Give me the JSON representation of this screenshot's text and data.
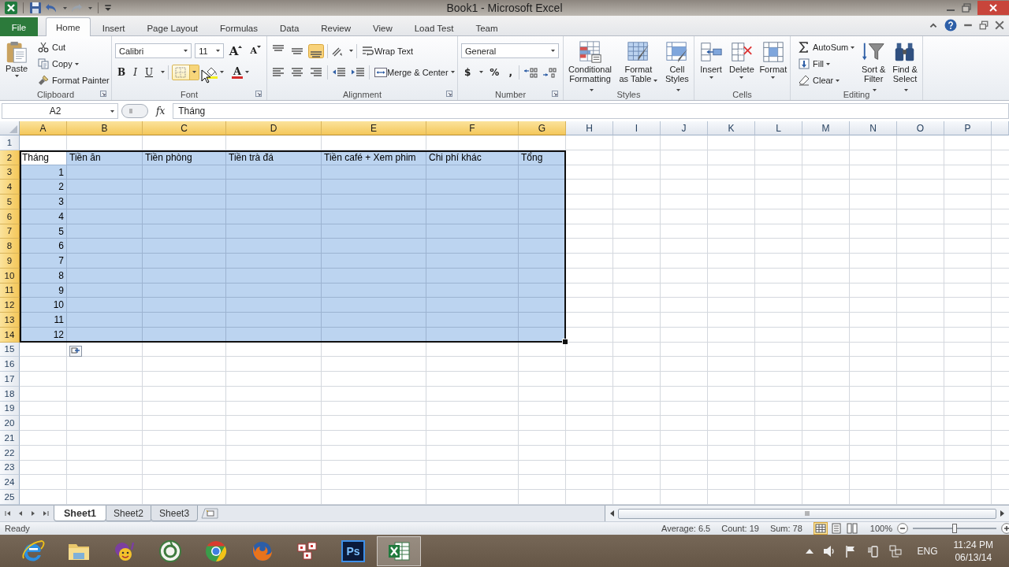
{
  "window": {
    "title": "Book1 - Microsoft Excel"
  },
  "ribbon_tabs": [
    {
      "label": "File",
      "kind": "file",
      "selected": false
    },
    {
      "label": "Home",
      "kind": "tab",
      "selected": true
    },
    {
      "label": "Insert",
      "kind": "tab",
      "selected": false
    },
    {
      "label": "Page Layout",
      "kind": "tab",
      "selected": false
    },
    {
      "label": "Formulas",
      "kind": "tab",
      "selected": false
    },
    {
      "label": "Data",
      "kind": "tab",
      "selected": false
    },
    {
      "label": "Review",
      "kind": "tab",
      "selected": false
    },
    {
      "label": "View",
      "kind": "tab",
      "selected": false
    },
    {
      "label": "Load Test",
      "kind": "tab",
      "selected": false
    },
    {
      "label": "Team",
      "kind": "tab",
      "selected": false
    }
  ],
  "ribbon": {
    "clipboard": {
      "label": "Clipboard",
      "paste": "Paste",
      "cut": "Cut",
      "copy": "Copy",
      "format_painter": "Format Painter"
    },
    "font": {
      "label": "Font",
      "font_name": "Calibri",
      "font_size": "11",
      "grow": "A",
      "shrink": "A",
      "bold": "B",
      "italic": "I",
      "underline": "U",
      "borders": {
        "hovered": true
      },
      "font_color": "A"
    },
    "alignment": {
      "label": "Alignment",
      "vertical_align": [
        {
          "selected": false
        },
        {
          "selected": false
        },
        {
          "selected": true
        }
      ],
      "wrap_text": "Wrap Text",
      "merge_center": "Merge & Center"
    },
    "number": {
      "label": "Number",
      "format": "General",
      "currency": "$",
      "percent": "%",
      "comma": ","
    },
    "styles": {
      "label": "Styles",
      "buttons": [
        "Conditional\nFormatting",
        "Format\nas Table",
        "Cell\nStyles"
      ]
    },
    "cells": {
      "label": "Cells",
      "buttons": [
        "Insert",
        "Delete",
        "Format"
      ]
    },
    "editing": {
      "label": "Editing",
      "autosum": "AutoSum",
      "fill": "Fill",
      "clear": "Clear",
      "sort_filter": "Sort &\nFilter",
      "find_select": "Find &\nSelect"
    }
  },
  "formula_bar": {
    "name_box": "A2",
    "function_button": "fx",
    "value": "Tháng"
  },
  "sheet": {
    "columns": [
      {
        "label": "A",
        "selected": true
      },
      {
        "label": "B",
        "selected": true
      },
      {
        "label": "C",
        "selected": true
      },
      {
        "label": "D",
        "selected": true
      },
      {
        "label": "E",
        "selected": true
      },
      {
        "label": "F",
        "selected": true
      },
      {
        "label": "G",
        "selected": true
      },
      {
        "label": "H",
        "selected": false
      },
      {
        "label": "I",
        "selected": false
      },
      {
        "label": "J",
        "selected": false
      },
      {
        "label": "K",
        "selected": false
      },
      {
        "label": "L",
        "selected": false
      },
      {
        "label": "M",
        "selected": false
      },
      {
        "label": "N",
        "selected": false
      },
      {
        "label": "O",
        "selected": false
      },
      {
        "label": "P",
        "selected": false
      }
    ],
    "rows": [
      {
        "label": "1",
        "selected": false
      },
      {
        "label": "2",
        "selected": true,
        "cells": [
          {
            "text": "Tháng",
            "kind": "text",
            "bold": false,
            "active": true
          },
          {
            "text": "Tiền ăn",
            "kind": "text",
            "bold": false,
            "active": false
          },
          {
            "text": "Tiền phòng",
            "kind": "text",
            "bold": false,
            "active": false
          },
          {
            "text": "Tiền trà đá",
            "kind": "text",
            "bold": false,
            "active": false
          },
          {
            "text": "Tiền café + Xem phim",
            "kind": "text",
            "bold": false,
            "active": false
          },
          {
            "text": "Chi phí khác",
            "kind": "text",
            "bold": false,
            "active": false
          },
          {
            "text": "Tổng",
            "kind": "text",
            "bold": false,
            "active": false
          }
        ]
      },
      {
        "label": "3",
        "selected": true,
        "cells": [
          {
            "text": "1",
            "kind": "number",
            "bold": false,
            "active": false
          }
        ]
      },
      {
        "label": "4",
        "selected": true,
        "cells": [
          {
            "text": "2",
            "kind": "number",
            "bold": false,
            "active": false
          }
        ]
      },
      {
        "label": "5",
        "selected": true,
        "cells": [
          {
            "text": "3",
            "kind": "number",
            "bold": false,
            "active": false
          }
        ]
      },
      {
        "label": "6",
        "selected": true,
        "cells": [
          {
            "text": "4",
            "kind": "number",
            "bold": false,
            "active": false
          }
        ]
      },
      {
        "label": "7",
        "selected": true,
        "cells": [
          {
            "text": "5",
            "kind": "number",
            "bold": false,
            "active": false
          }
        ]
      },
      {
        "label": "8",
        "selected": true,
        "cells": [
          {
            "text": "6",
            "kind": "number",
            "bold": false,
            "active": false
          }
        ]
      },
      {
        "label": "9",
        "selected": true,
        "cells": [
          {
            "text": "7",
            "kind": "number",
            "bold": false,
            "active": false
          }
        ]
      },
      {
        "label": "10",
        "selected": true,
        "cells": [
          {
            "text": "8",
            "kind": "number",
            "bold": false,
            "active": false
          }
        ]
      },
      {
        "label": "11",
        "selected": true,
        "cells": [
          {
            "text": "9",
            "kind": "number",
            "bold": false,
            "active": false
          }
        ]
      },
      {
        "label": "12",
        "selected": true,
        "cells": [
          {
            "text": "10",
            "kind": "number",
            "bold": false,
            "active": false
          }
        ]
      },
      {
        "label": "13",
        "selected": true,
        "cells": [
          {
            "text": "11",
            "kind": "number",
            "bold": false,
            "active": false
          }
        ]
      },
      {
        "label": "14",
        "selected": true,
        "cells": [
          {
            "text": "12",
            "kind": "number",
            "bold": false,
            "active": false
          }
        ]
      },
      {
        "label": "15",
        "selected": false
      },
      {
        "label": "16",
        "selected": false
      },
      {
        "label": "17",
        "selected": false
      },
      {
        "label": "18",
        "selected": false
      },
      {
        "label": "19",
        "selected": false
      },
      {
        "label": "20",
        "selected": false
      },
      {
        "label": "21",
        "selected": false
      },
      {
        "label": "22",
        "selected": false
      },
      {
        "label": "23",
        "selected": false
      },
      {
        "label": "24",
        "selected": false
      },
      {
        "label": "25",
        "selected": false
      }
    ]
  },
  "sheet_tabs": [
    {
      "label": "Sheet1",
      "selected": true
    },
    {
      "label": "Sheet2",
      "selected": false
    },
    {
      "label": "Sheet3",
      "selected": false
    }
  ],
  "status_bar": {
    "mode": "Ready",
    "average": "Average: 6.5",
    "count": "Count: 19",
    "sum": "Sum: 78",
    "views": [
      {
        "selected": true
      },
      {
        "selected": false
      },
      {
        "selected": false
      }
    ],
    "zoom": {
      "label": "100%",
      "level": 0.5
    }
  },
  "taskbar": {
    "apps": [
      {
        "kind": "ie",
        "selected": false
      },
      {
        "kind": "explorer",
        "selected": false
      },
      {
        "kind": "messenger",
        "selected": false
      },
      {
        "kind": "coccoc",
        "selected": false
      },
      {
        "kind": "chrome",
        "selected": false
      },
      {
        "kind": "firefox",
        "selected": false
      },
      {
        "kind": "unikey",
        "selected": false
      },
      {
        "kind": "photoshop",
        "label": "Ps",
        "selected": false
      },
      {
        "kind": "excel",
        "selected": true
      }
    ],
    "language": "ENG",
    "time": "11:24 PM",
    "date": "06/13/14"
  }
}
